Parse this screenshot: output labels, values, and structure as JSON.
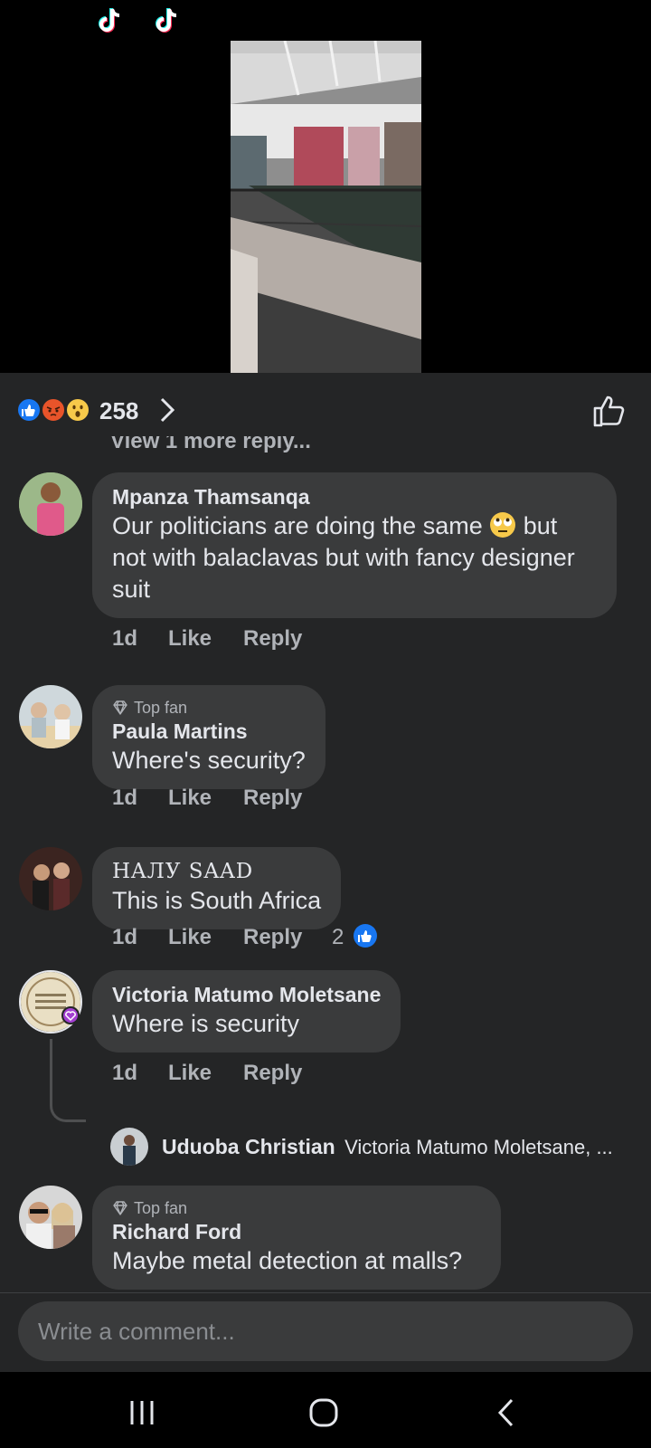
{
  "video": {
    "tiktok_icon_left": "tiktok-logo",
    "tiktok_icon_right": "tiktok-logo"
  },
  "reactions": {
    "icons": [
      "like",
      "angry",
      "wow"
    ],
    "count": "258"
  },
  "view_more": "View 1 more reply...",
  "comments": [
    {
      "author": "Mpanza Thamsanqa",
      "text_line1": "Our politicians are doing the same",
      "emoji": "eye-roll",
      "text_line1b": "but",
      "text_line2": "not with balaclavas but with fancy designer",
      "text_line3": "suit",
      "time": "1d",
      "like": "Like",
      "reply": "Reply"
    },
    {
      "badge": "Top fan",
      "author": "Paula Martins",
      "text": "Where's security?",
      "time": "1d",
      "like": "Like",
      "reply": "Reply"
    },
    {
      "author": "HAЛУ SAAD",
      "text": "This is South Africa",
      "time": "1d",
      "like": "Like",
      "reply": "Reply",
      "reaction_count": "2"
    },
    {
      "author": "Victoria Matumo Moletsane",
      "text": "Where is security",
      "time": "1d",
      "like": "Like",
      "reply": "Reply"
    },
    {
      "badge": "Top fan",
      "author": "Richard Ford",
      "text": "Maybe metal detection at malls?"
    }
  ],
  "reply_preview": {
    "author": "Uduoba Christian",
    "text": "Victoria Matumo Moletsane, ..."
  },
  "input": {
    "placeholder": "Write a comment..."
  },
  "colors": {
    "panel_bg": "#242526",
    "bubble_bg": "#3a3b3c",
    "like_blue": "#1877f2"
  }
}
